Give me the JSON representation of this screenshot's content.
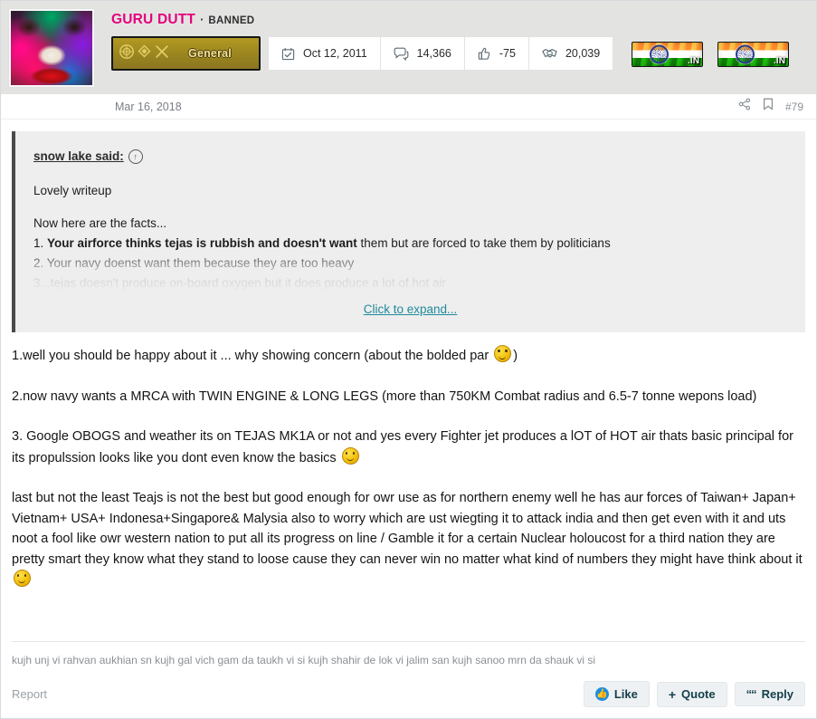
{
  "user": {
    "name": "GURU DUTT",
    "separator": "·",
    "status": "BANNED",
    "rank_title": "General"
  },
  "stats": [
    {
      "icon": "calendar-icon",
      "label": "Joined",
      "value": "Oct 12, 2011"
    },
    {
      "icon": "messages-icon",
      "label": "Messages",
      "value": "14,366"
    },
    {
      "icon": "thumbs-up-icon",
      "label": "Reaction score",
      "value": "-75"
    },
    {
      "icon": "handshake-icon",
      "label": "Points",
      "value": "20,039"
    }
  ],
  "flags": [
    {
      "name": "india-flag-badge",
      "tld": ".IN"
    },
    {
      "name": "india-flag-badge",
      "tld": ".IN"
    }
  ],
  "post_meta": {
    "date": "Mar 16, 2018",
    "share_icon": "share-icon",
    "bookmark_icon": "bookmark-icon",
    "post_number": "#79"
  },
  "quote": {
    "attribution": "snow lake said:",
    "jump_icon": "jump-to-post-icon",
    "lines": [
      "Lovely writeup",
      "Now here are the facts...",
      "1. Your airforce thinks tejas is rubbish and doesn't want them but are forced to take them by politicians",
      "2. Your navy doenst want them because they are too heavy",
      "3...tejas doesn't produce on-board oxygen but it does produce a lot of hot air"
    ],
    "line3_bold": "Your airforce thinks tejas is rubbish and doesn't want",
    "line3_rest": " them but are forced to take them by politicians",
    "line3_prefix": "1. ",
    "expand_label": "Click to expand..."
  },
  "body": {
    "p1_before": "1.well you should be happy about it ... why showing concern (about the bolded par ",
    "p1_after": ")",
    "p2": "2.now navy wants a MRCA with TWIN ENGINE & LONG LEGS (more than 750KM Combat radius and 6.5-7 tonne wepons load)",
    "p3_before": "3. Google OBOGS and weather its on TEJAS MK1A or not and yes every Fighter jet produces a lOT of HOT air thats basic principal for its propulssion looks like you dont even know the basics ",
    "p4_before": "last but not the least Teajs is not the best but good enough for owr use as for northern enemy well he has aur forces of Taiwan+ Japan+ Vietnam+ USA+ Indonesa+Singapore& Malysia also to worry which are ust wiegting it to attack india and then get even with it and uts noot a fool like owr western nation to put all its progress on line / Gamble it for a certain Nuclear holoucost for a third nation they are pretty smart they know what they stand to loose cause they can never win no matter what kind of numbers they might have think about it "
  },
  "signature": "kujh unj vi rahvan aukhian sn kujh gal vich gam da taukh vi si kujh shahir de lok vi jalim san kujh sanoo mrn da shauk vi si",
  "footer": {
    "report": "Report",
    "like": "Like",
    "quote": "Quote",
    "reply": "Reply",
    "plus": "+"
  },
  "colors": {
    "username": "#e5007d",
    "link": "#1f8a9b",
    "rank_bg": "#9d8720",
    "like_blue": "#1b8fe0"
  }
}
